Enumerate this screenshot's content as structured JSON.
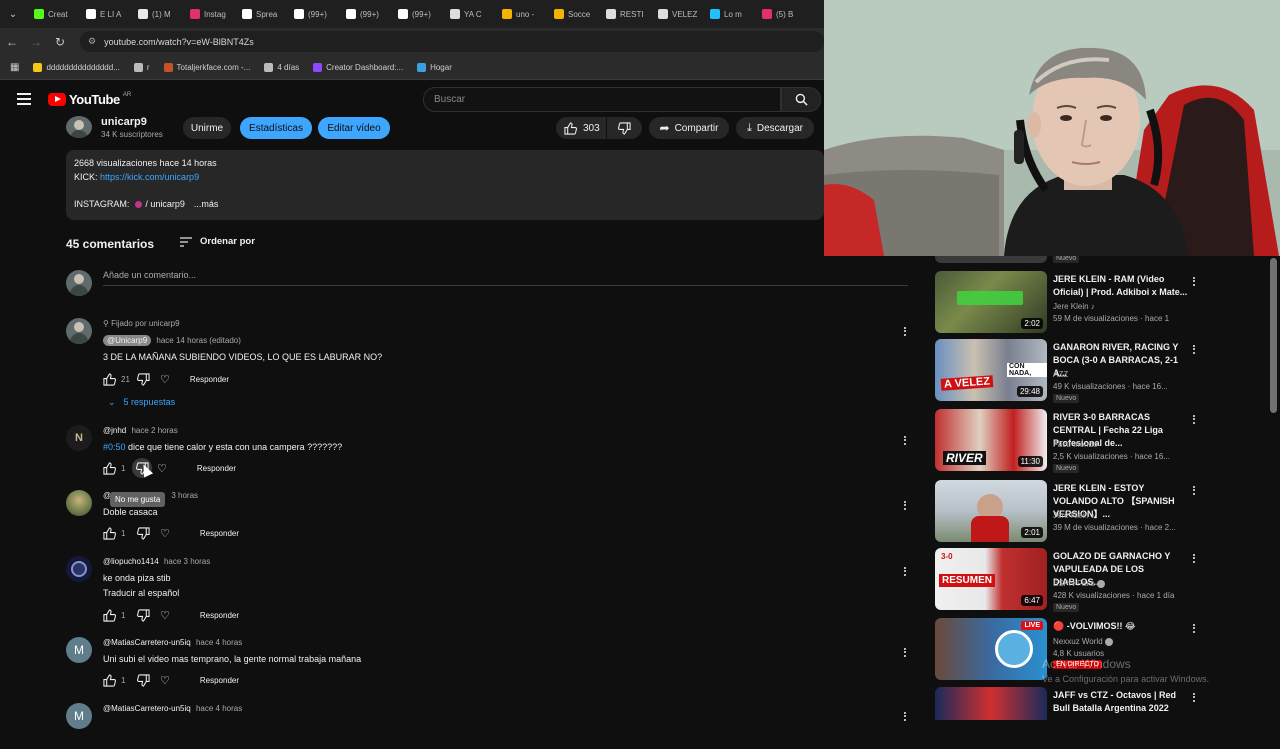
{
  "browser": {
    "tabs": [
      {
        "label": "Creat",
        "color": "#53fc18"
      },
      {
        "label": "E LI A",
        "color": "#ffffff"
      },
      {
        "label": "(1) M",
        "color": "#e7e9ea"
      },
      {
        "label": "Instag",
        "color": "#e1306c"
      },
      {
        "label": "Sprea",
        "color": "#ffffff"
      },
      {
        "label": "(99+)",
        "color": "#ffffff"
      },
      {
        "label": "(99+)",
        "color": "#ffffff"
      },
      {
        "label": "(99+)",
        "color": "#ffffff"
      },
      {
        "label": "YA C",
        "color": "#dddddd"
      },
      {
        "label": "uno -",
        "color": "#f5b301"
      },
      {
        "label": "Socce",
        "color": "#f5b301"
      },
      {
        "label": "RESTI",
        "color": "#dddddd"
      },
      {
        "label": "VELEZ",
        "color": "#dddddd"
      },
      {
        "label": "Lo m",
        "color": "#20c0ff"
      },
      {
        "label": "(5) B",
        "color": "#e1306c"
      }
    ],
    "url": "youtube.com/watch?v=eW-BlBNT4Zs",
    "bookmarks": [
      {
        "label": "ddddddddddddddd...",
        "color": "#f5c518"
      },
      {
        "label": "r",
        "color": "#bbbbbb"
      },
      {
        "label": "Totaljerkface.com -...",
        "color": "#c7512b"
      },
      {
        "label": "4 días",
        "color": "#bbbbbb"
      },
      {
        "label": "Creator Dashboard:...",
        "color": "#9146ff"
      },
      {
        "label": "Hogar",
        "color": "#3aa0e0"
      }
    ]
  },
  "youtube": {
    "logo_text": "YouTube",
    "country": "AR",
    "search_placeholder": "Buscar"
  },
  "channel": {
    "name": "unicarp9",
    "subscribers": "34 K suscriptores",
    "join_label": "Unirme",
    "stats_label": "Estadísticas",
    "edit_label": "Editar vídeo",
    "likes": "303",
    "share_label": "Compartir",
    "download_label": "Descargar"
  },
  "description": {
    "views_line": "2668 visualizaciones  hace 14 horas",
    "kick_label": "KICK:",
    "kick_url": "https://kick.com/unicarp9",
    "instagram_label": "INSTAGRAM:",
    "instagram_handle": "/ unicarp9",
    "more_label": "...más"
  },
  "comments_section": {
    "count_label": "45 comentarios",
    "sort_label": "Ordenar por",
    "add_placeholder": "Añade un comentario..."
  },
  "comments": [
    {
      "pinned_label": "Fijado por unicarp9",
      "author": "@Unicarp9",
      "time": "hace 14 horas (editado)",
      "text": "3 DE LA MAÑANA SUBIENDO VIDEOS, LO QUE ES LABURAR NO?",
      "likes": "21",
      "reply_label": "Responder",
      "replies_label": "5 respuestas"
    },
    {
      "author": "@jnhd",
      "time": "hace 2 horas",
      "timestamp_link": "#0:50",
      "text": " dice que tiene calor y esta con una campera ???????",
      "likes": "1",
      "reply_label": "Responder",
      "tooltip": "No me gusta"
    },
    {
      "author": "@",
      "time": "3 horas",
      "text": "Doble casaca",
      "likes": "1",
      "reply_label": "Responder"
    },
    {
      "author": "@liopucho1414",
      "time": "hace 3 horas",
      "text": "ke onda piza stib",
      "translate_label": "Traducir al español",
      "likes": "1",
      "reply_label": "Responder"
    },
    {
      "author": "@MatiasCarretero-un5iq",
      "time": "hace 4 horas",
      "text": "Uni subi el video mas temprano, la gente normal trabaja mañana",
      "likes": "1",
      "reply_label": "Responder",
      "avatar_letter": "M"
    },
    {
      "author": "@MatiasCarretero-un5iq",
      "time": "hace 4 horas",
      "avatar_letter": "M"
    }
  ],
  "sidebar": {
    "top_badge": "Nuevo",
    "videos": [
      {
        "title": "JERE KLEIN - RAM (Video Oficial) | Prod. Adkiboi x Mate...",
        "channel": "Jere Klein ♪",
        "stats": "59 M de visualizaciones · hace 1",
        "duration": "2:02"
      },
      {
        "title": "GANARON RIVER, RACING Y BOCA (3-0 A BARRACAS, 2-1 A...",
        "channel": "AZZ",
        "stats": "49 K visualizaciones · hace 16...",
        "duration": "29:48",
        "badge": "Nuevo"
      },
      {
        "title": "RIVER 3-0 BARRACAS CENTRAL | Fecha 22 Liga Profesional de...",
        "channel": "Facu Iriondo",
        "stats": "2,5 K visualizaciones · hace 16...",
        "duration": "11:30",
        "badge": "Nuevo"
      },
      {
        "title": "JERE KLEIN - ESTOY VOLANDO ALTO 【SPANISH VERSION】...",
        "channel": "Jere Klein ♪",
        "stats": "39 M de visualizaciones · hace 2...",
        "duration": "2:01"
      },
      {
        "title": "GOLAZO DE GARNACHO Y VAPULEADA DE LOS DIABLOS...",
        "channel": "ESPN Fans",
        "stats": "428 K visualizaciones · hace 1 día",
        "duration": "6:47",
        "badge": "Nuevo"
      },
      {
        "title": "🔴 -VOLVIMOS!! 😂",
        "channel": "Nexxuz World",
        "stats": "4,8 K usuarios",
        "live_badge": "LIVE",
        "live_label": "EN DIRECTO"
      },
      {
        "title": "JAFF vs CTZ - Octavos | Red Bull Batalla Argentina 2022",
        "channel": "",
        "stats": ""
      }
    ]
  },
  "watermark": {
    "line1": "Activar Windows",
    "line2": "Ve a Configuración para activar Windows."
  },
  "colors": {
    "accent_blue": "#3ea6ff",
    "yt_red": "#ff0000",
    "bg": "#0f0f0f",
    "chip": "#272727"
  }
}
